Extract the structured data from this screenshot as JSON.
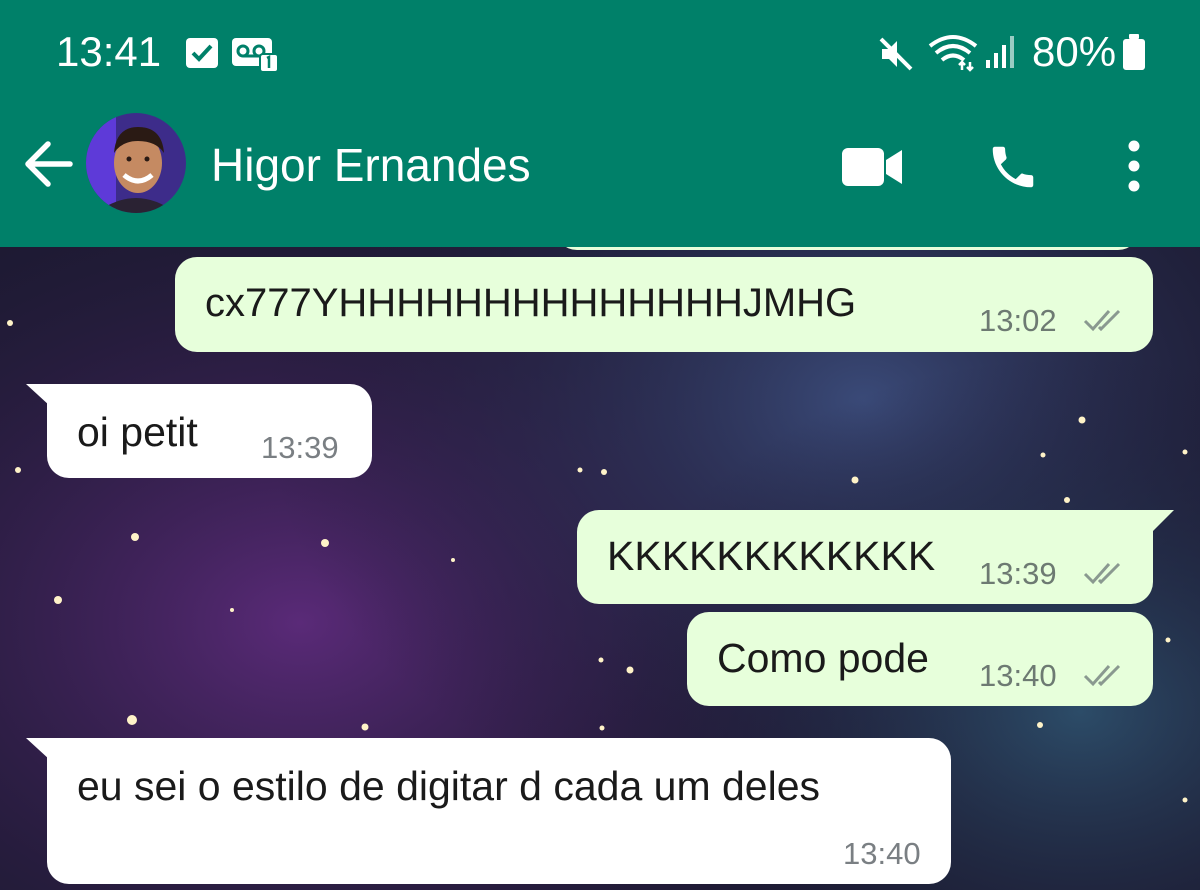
{
  "status_bar": {
    "time": "13:41",
    "battery": "80%"
  },
  "header": {
    "contact_name": "Higor Ernandes",
    "icons": [
      "back-arrow-icon",
      "avatar",
      "video-call-icon",
      "phone-icon",
      "more-vert-icon"
    ]
  },
  "colors": {
    "header_bg": "#008069",
    "outgoing_bubble": "#e7ffdb",
    "incoming_bubble": "#ffffff"
  },
  "messages": [
    {
      "direction": "out",
      "text": "cx777YHHHHHHHHHHHHHHJMHG",
      "time": "13:02",
      "read": true
    },
    {
      "direction": "in",
      "text": "oi petit",
      "time": "13:39"
    },
    {
      "direction": "out",
      "text": "KKKKKKKKKKKK",
      "time": "13:39",
      "read": true
    },
    {
      "direction": "out",
      "text": "Como pode",
      "time": "13:40",
      "read": true
    },
    {
      "direction": "in",
      "text": "eu sei o estilo de digitar d cada um deles",
      "time": "13:40"
    }
  ]
}
